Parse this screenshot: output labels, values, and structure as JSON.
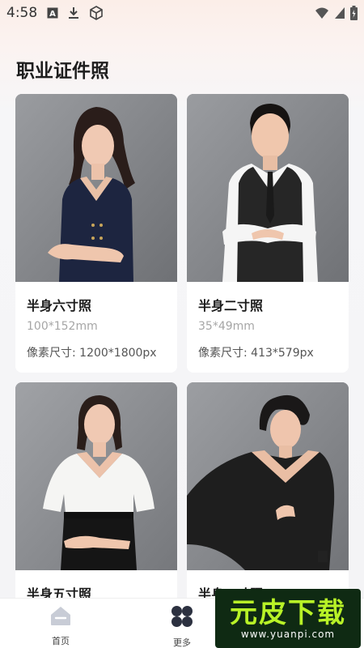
{
  "status_bar": {
    "time": "4:58",
    "left_icons": [
      "a-box-icon",
      "download-icon",
      "cube-icon"
    ],
    "right_icons": [
      "wifi-icon",
      "signal-icon",
      "battery-icon"
    ]
  },
  "page": {
    "title": "职业证件照"
  },
  "cards": [
    {
      "name": "半身六寸照",
      "size": "100*152mm",
      "pixels": "像素尺寸: 1200*1800px"
    },
    {
      "name": "半身二寸照",
      "size": "35*49mm",
      "pixels": "像素尺寸: 413*579px"
    },
    {
      "name": "半身五寸照",
      "size": "",
      "pixels": ""
    },
    {
      "name": "半身一寸照",
      "size": "",
      "pixels": ""
    }
  ],
  "bottom_nav": {
    "items": [
      {
        "label": "首页",
        "icon": "home-icon"
      },
      {
        "label": "更多",
        "icon": "grid-more-icon"
      }
    ]
  },
  "watermark": {
    "main": "元皮下载",
    "sub": "www.yuanpi.com"
  }
}
